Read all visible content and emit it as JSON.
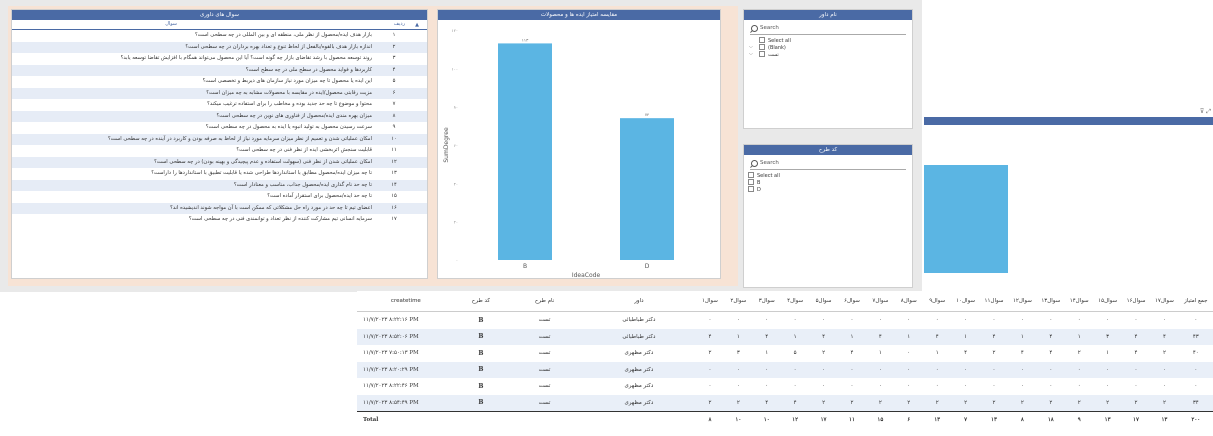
{
  "questions_visual": {
    "title": "سوال های داوری",
    "col_question": "سوال",
    "col_row": "ردیف",
    "sort_icon": "triangle-up-icon",
    "rows": [
      {
        "n": "۱",
        "q": "بازار هدف ایده/محصول از نظر ملی، منطقه ای و بین المللی در چه سطحی است؟"
      },
      {
        "n": "۲",
        "q": "اندازه بازار هدف بالقوه/بالفعل از لحاظ تنوع و تعداد بهره برداران در چه سطحی است؟"
      },
      {
        "n": "۳",
        "q": "روند توسعه محصول با رشد تقاضای بازار چه گونه است؟ آیا این محصول می‌تواند همگام با افزایش تقاضا توسعه یابد؟"
      },
      {
        "n": "۴",
        "q": "کاربردها و فواید محصول در سطح ملی در چه سطح است؟"
      },
      {
        "n": "۵",
        "q": "این ایده یا محصول تا چه میزان مورد نیاز سازمان های ذیربط و تخصصی است؟"
      },
      {
        "n": "۶",
        "q": "مزیت رقابتی محصول/ایده در مقایسه با محصولات مشابه به چه میزان است؟"
      },
      {
        "n": "۷",
        "q": "محتوا و موضوع تا چه حد جدید بوده و مخاطب را برای استفاده ترغیب میکند؟"
      },
      {
        "n": "۸",
        "q": "میزان بهره مندی ایده/محصول از فناوری های نوین در چه سطحی است؟"
      },
      {
        "n": "۹",
        "q": "سرعت رسیدن محصول به تولید انبوه یا ایده به محصول در چه سطحی است؟"
      },
      {
        "n": "۱۰",
        "q": "امکان عملیاتی شدن و تعمیم از نظر میزان سرمایه مورد نیاز از لحاظ به صرفه بودن و کاربرد در آینده در چه سطحی است؟"
      },
      {
        "n": "۱۱",
        "q": "قابلیت سنجش اثربخشی ایده از نظر فنی در چه سطحی است؟"
      },
      {
        "n": "۱۲",
        "q": "امکان عملیاتی شدن از نظر فنی (سهولت استفاده و عدم پیچیدگی و بهینه بودن) در چه سطحی است؟"
      },
      {
        "n": "۱۳",
        "q": "تا چه میزان ایده/محصول مطابق با استانداردها طراحی شده یا قابلیت تطبیق با استانداردها را داراست؟"
      },
      {
        "n": "۱۴",
        "q": "تا چه حد نام گذاری ایده/محصول جذاب، مناسب و معنادار است؟"
      },
      {
        "n": "۱۵",
        "q": "تا چه حد ایده/محصول برای استقرار آماده است؟"
      },
      {
        "n": "۱۶",
        "q": "اعضای تیم تا چه حد در مورد راه حل مشکلاتی که ممکن است با آن مواجه شوند اندیشیده اند؟"
      },
      {
        "n": "۱۷",
        "q": "سرمایه انسانی تیم مشارکت کننده از نظر تعداد و توانمندی فنی در چه سطحی است؟"
      }
    ]
  },
  "chart_visual": {
    "title": "مقایسه امتیاز ایده ها و محصولات",
    "bar_color": "#5bb5e3"
  },
  "chart_data": {
    "type": "bar",
    "categories": [
      "B",
      "D"
    ],
    "values": [
      113,
      74
    ],
    "data_labels": [
      "۱۱۳",
      "۷۴"
    ],
    "xlabel": "IdeaCode",
    "ylabel": "SumDegree",
    "ylim": [
      0,
      120
    ],
    "y_ticks": [
      0,
      20,
      40,
      60,
      80,
      100,
      120
    ],
    "y_tick_labels": [
      "۰",
      "۲۰",
      "۴۰",
      "۶۰",
      "۸۰",
      "۱۰۰",
      "۱۲۰"
    ],
    "grid": false
  },
  "judge_slicer": {
    "title": "نام داور",
    "search_placeholder": "Search",
    "items": [
      "Select all",
      "(Blank)",
      "تست"
    ]
  },
  "design_slicer": {
    "title": "کد طرح",
    "search_placeholder": "Search",
    "items": [
      "Select all",
      "B",
      "D"
    ]
  },
  "bg_visual": {
    "icons": "⊽ ⤢"
  },
  "details_table": {
    "headers": [
      "createtime",
      "کد طرح",
      "نام طرح",
      "داور",
      "سوال۱",
      "سوال۲",
      "سوال۳",
      "سوال۴",
      "سوال۵",
      "سوال۶",
      "سوال۷",
      "سوال۸",
      "سوال۹",
      "سوال۱۰",
      "سوال۱۱",
      "سوال۱۲",
      "سوال۱۳",
      "سوال۱۴",
      "سوال۱۵",
      "سوال۱۶",
      "سوال۱۷",
      "جمع امتیاز"
    ],
    "rows": [
      [
        "۱۱/۷/۲۰۲۳ ۸:۲۲:۱۶ PM",
        "B",
        "تست",
        "دکتر طباطبائی",
        "۰",
        "۰",
        "۰",
        "۰",
        "۰",
        "۰",
        "۰",
        "۰",
        "۰",
        "۰",
        "۰",
        "۰",
        "۰",
        "۰",
        "۰",
        "۰",
        "۰",
        "۰"
      ],
      [
        "۱۱/۷/۲۰۲۳ ۸:۵۲:۰۶ PM",
        "B",
        "تست",
        "دکتر طباطبائی",
        "۴",
        "۱",
        "۴",
        "۱",
        "۴",
        "۱",
        "۴",
        "۱",
        "۴",
        "۱",
        "۴",
        "۱",
        "۴",
        "۱",
        "۳",
        "۴",
        "۴",
        "۴۳"
      ],
      [
        "۱۱/۷/۲۰۲۳ ۷:۵۰:۱۳ PM",
        "B",
        "تست",
        "دکتر مظهری",
        "۲",
        "۳",
        "۱",
        "۵",
        "۲",
        "۴",
        "۱",
        "۰",
        "۱",
        "۴",
        "۲",
        "۴",
        "۴",
        "۲",
        "۱",
        "۴",
        "۲",
        "۴۰"
      ],
      [
        "۱۱/۷/۲۰۲۳ ۸:۲۰:۲۹ PM",
        "B",
        "تست",
        "دکتر مظهری",
        "۰",
        "۰",
        "۰",
        "۰",
        "۰",
        "۰",
        "۰",
        "۰",
        "۰",
        "۰",
        "۰",
        "۰",
        "۰",
        "۰",
        "۰",
        "۰",
        "۰",
        "۰"
      ],
      [
        "۱۱/۷/۲۰۲۳ ۸:۲۲:۴۶ PM",
        "B",
        "تست",
        "دکتر مظهری",
        "۰",
        "۰",
        "۰",
        "۰",
        "۰",
        "۰",
        "۰",
        "۰",
        "۰",
        "۰",
        "۰",
        "۰",
        "۰",
        "۰",
        "۰",
        "۰",
        "۰",
        "۰"
      ],
      [
        "۱۱/۷/۲۰۲۳ ۸:۵۴:۴۹ PM",
        "B",
        "تست",
        "دکتر مظهری",
        "۲",
        "۲",
        "۴",
        "۴",
        "۲",
        "۲",
        "۲",
        "۲",
        "۲",
        "۲",
        "۲",
        "۲",
        "۲",
        "۲",
        "۲",
        "۲",
        "۲",
        "۳۴"
      ]
    ],
    "total": [
      "Total",
      "",
      "",
      "",
      "۸",
      "۱۰",
      "۱۰",
      "۱۲",
      "۱۷",
      "۱۱",
      "۱۵",
      "۶",
      "۱۳",
      "۷",
      "۱۳",
      "۸",
      "۱۸",
      "۹",
      "۱۳",
      "۱۷",
      "۱۳",
      "۲۰۰"
    ]
  }
}
